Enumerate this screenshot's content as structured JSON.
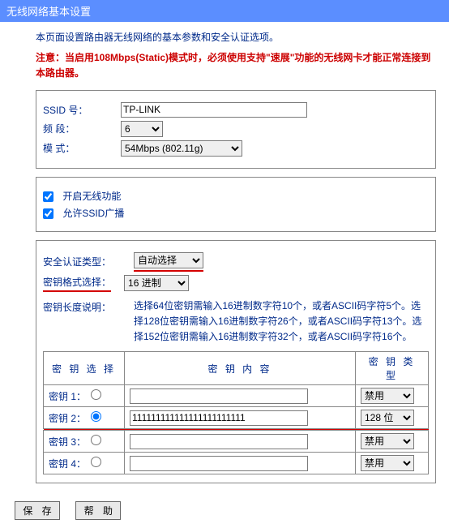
{
  "title": "无线网络基本设置",
  "intro": "本页面设置路由器无线网络的基本参数和安全认证选项。",
  "notice": "注意：当启用108Mbps(Static)模式时，必须使用支持\"速展\"功能的无线网卡才能正常连接到本路由器。",
  "basic": {
    "ssid_label": "SSID 号：",
    "ssid_value": "TP-LINK",
    "band_label": "频 段：",
    "band_value": "6",
    "mode_label": "模 式：",
    "mode_value": "54Mbps (802.11g)"
  },
  "toggles": {
    "enable_wireless": "开启无线功能",
    "allow_broadcast": "允许SSID广播"
  },
  "security": {
    "auth_label": "安全认证类型：",
    "auth_value": "自动选择",
    "format_label": "密钥格式选择：",
    "format_value": "16 进制",
    "length_label": "密钥长度说明：",
    "length_desc": "选择64位密钥需输入16进制数字符10个，或者ASCII码字符5个。选择128位密钥需输入16进制数字符26个，或者ASCII码字符13个。选择152位密钥需输入16进制数字符32个，或者ASCII码字符16个。"
  },
  "keys": {
    "headers": {
      "select": "密 钥 选 择",
      "content": "密 钥 内 容",
      "type": "密 钥 类 型"
    },
    "rows": [
      {
        "label": "密钥 1：",
        "selected": false,
        "content": "",
        "type": "禁用"
      },
      {
        "label": "密钥 2：",
        "selected": true,
        "content": "111111111111111111111111",
        "type": "128 位"
      },
      {
        "label": "密钥 3：",
        "selected": false,
        "content": "",
        "type": "禁用"
      },
      {
        "label": "密钥 4：",
        "selected": false,
        "content": "",
        "type": "禁用"
      }
    ]
  },
  "buttons": {
    "save": "保 存",
    "help": "帮 助"
  }
}
